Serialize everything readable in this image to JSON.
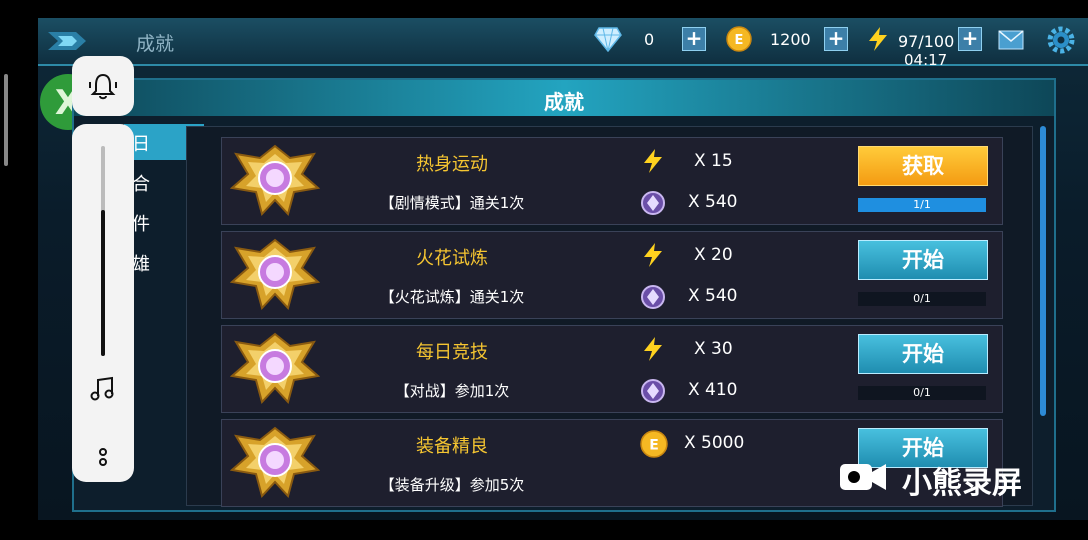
{
  "header": {
    "title": "成就",
    "gems": "0",
    "coins": "1200",
    "energy": "97/100",
    "time": "04:17"
  },
  "panel": {
    "title": "成就"
  },
  "tabs": [
    {
      "label": "日",
      "badge": true,
      "active": true
    },
    {
      "label": "合",
      "badge": true,
      "active": false
    },
    {
      "label": "件",
      "badge": false,
      "active": false
    },
    {
      "label": "雄",
      "badge": false,
      "active": false
    }
  ],
  "achievements": [
    {
      "title": "热身运动",
      "desc": "【剧情模式】通关1次",
      "reward1": "X 15",
      "reward2": "X 540",
      "button": "获取",
      "progress": "1/1"
    },
    {
      "title": "火花试炼",
      "desc": "【火花试炼】通关1次",
      "reward1": "X 20",
      "reward2": "X 540",
      "button": "开始",
      "progress": "0/1"
    },
    {
      "title": "每日竞技",
      "desc": "【对战】参加1次",
      "reward1": "X 30",
      "reward2": "X 410",
      "button": "开始",
      "progress": "0/1"
    },
    {
      "title": "装备精良",
      "desc": "【装备升级】参加5次",
      "reward1": "X 5000",
      "button": "开始"
    }
  ],
  "overlay": {
    "watermark": "小熊录屏"
  },
  "icons": {
    "back": "back-arrow-icon",
    "gem": "diamond-icon",
    "coin": "coin-icon",
    "energy": "lightning-icon",
    "mail": "mail-icon",
    "settings": "gear-icon",
    "bell": "bell-icon",
    "music": "music-note-icon",
    "more": "more-dots-icon",
    "medal": "medal-icon",
    "crystal": "crystal-icon",
    "record": "video-camera-icon"
  },
  "colors": {
    "accent": "#2ba3c7",
    "gold": "#f5c531",
    "claim": "#f49b12"
  }
}
